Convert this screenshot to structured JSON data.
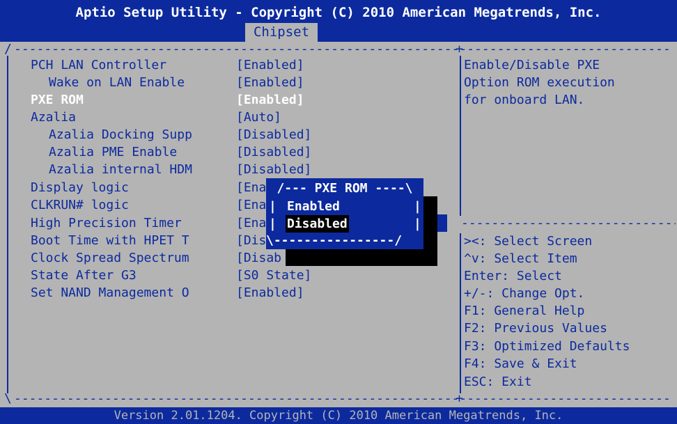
{
  "header": {
    "title": "Aptio Setup Utility - Copyright (C) 2010 American Megatrends, Inc.",
    "active_tab": "Chipset"
  },
  "settings": [
    {
      "label": "PCH LAN Controller",
      "value": "[Enabled]"
    },
    {
      "label": "Wake on LAN Enable",
      "value": "[Enabled]"
    },
    {
      "label": "PXE ROM",
      "value": "[Enabled]"
    },
    {
      "label": "Azalia",
      "value": "[Auto]"
    },
    {
      "label": "Azalia Docking Supp",
      "value": "[Disabled]"
    },
    {
      "label": "Azalia PME Enable",
      "value": "[Disabled]"
    },
    {
      "label": "Azalia internal HDM",
      "value": "[Disabled]"
    },
    {
      "label": "Display logic",
      "value": "[Ena"
    },
    {
      "label": "CLKRUN# logic",
      "value": "[Ena"
    },
    {
      "label": "High Precision Timer",
      "value": "[Ena"
    },
    {
      "label": "Boot Time with HPET T",
      "value": "[Dis"
    },
    {
      "label": "Clock Spread Spectrum",
      "value": "[Disab"
    },
    {
      "label": "State After G3",
      "value": "[S0 State]"
    },
    {
      "label": "Set NAND Management O",
      "value": "[Enabled]"
    }
  ],
  "help_text": [
    "Enable/Disable PXE",
    "Option ROM execution",
    "for onboard LAN."
  ],
  "key_help": [
    "><: Select Screen",
    "^v: Select Item",
    "Enter: Select",
    "+/-: Change Opt.",
    "F1: General Help",
    "F2: Previous Values",
    "F3: Optimized Defaults",
    "F4: Save & Exit",
    "ESC: Exit"
  ],
  "popup": {
    "title": "/--- PXE ROM ----\\",
    "options": [
      "Enabled",
      "Disabled"
    ],
    "highlighted_option": "Disabled",
    "bottom": "\\----------------/"
  },
  "footer": {
    "version": "Version 2.01.1204. Copyright (C) 2010 American Megatrends, Inc."
  },
  "colors": {
    "background": "#b4b4b4",
    "bios_blue": "#0c2a9e",
    "selected_text": "#ffffff",
    "highlight": "#000000"
  }
}
